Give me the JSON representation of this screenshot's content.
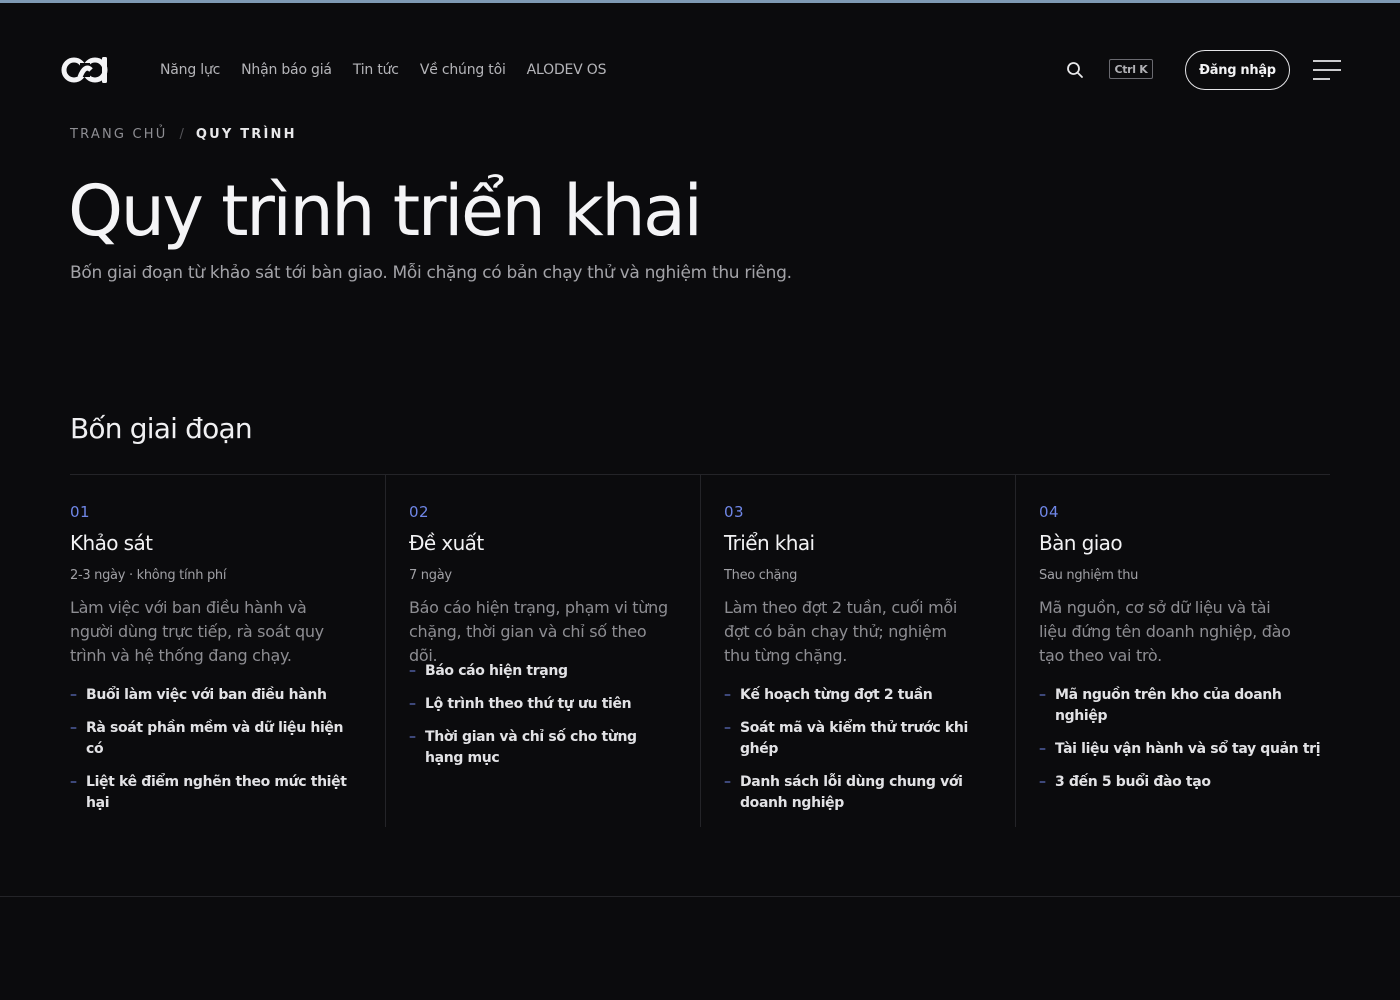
{
  "nav": {
    "items": [
      "Năng lực",
      "Nhận báo giá",
      "Tin tức",
      "Về chúng tôi",
      "ALODEV OS"
    ],
    "search_shortcut": "Ctrl K",
    "login_label": "Đăng nhập"
  },
  "breadcrumb": {
    "home": "TRANG CHỦ",
    "separator": "/",
    "current": "QUY TRÌNH"
  },
  "hero": {
    "title": "Quy trình triển khai",
    "subtitle": "Bốn giai đoạn từ khảo sát tới bàn giao. Mỗi chặng có bản chạy thử và nghiệm thu riêng."
  },
  "section": {
    "title": "Bốn giai đoạn"
  },
  "phases": [
    {
      "number": "01",
      "title": "Khảo sát",
      "meta": "2-3 ngày · không tính phí",
      "description": "Làm việc với ban điều hành và người dùng trực tiếp, rà soát quy trình và hệ thống đang chạy.",
      "items": [
        "Buổi làm việc với ban điều hành",
        "Rà soát phần mềm và dữ liệu hiện có",
        "Liệt kê điểm nghẽn theo mức thiệt hại"
      ]
    },
    {
      "number": "02",
      "title": "Đề xuất",
      "meta": "7 ngày",
      "description": "Báo cáo hiện trạng, phạm vi từng chặng, thời gian và chỉ số theo dõi.",
      "items": [
        "Báo cáo hiện trạng",
        "Lộ trình theo thứ tự ưu tiên",
        "Thời gian và chỉ số cho từng hạng mục"
      ]
    },
    {
      "number": "03",
      "title": "Triển khai",
      "meta": "Theo chặng",
      "description": "Làm theo đợt 2 tuần, cuối mỗi đợt có bản chạy thử; nghiệm thu từng chặng.",
      "items": [
        "Kế hoạch từng đợt 2 tuần",
        "Soát mã và kiểm thử trước khi ghép",
        "Danh sách lỗi dùng chung với doanh nghiệp"
      ]
    },
    {
      "number": "04",
      "title": "Bàn giao",
      "meta": "Sau nghiệm thu",
      "description": "Mã nguồn, cơ sở dữ liệu và tài liệu đứng tên doanh nghiệp, đào tạo theo vai trò.",
      "items": [
        "Mã nguồn trên kho của doanh nghiệp",
        "Tài liệu vận hành và sổ tay quản trị",
        "3 đến 5 buổi đào tạo"
      ]
    }
  ],
  "icons": {
    "logo": "logo-icon",
    "search": "search-icon",
    "menu": "menu-icon"
  },
  "colors": {
    "background": "#0b0b0d",
    "accent": "#6f86e6",
    "top_bar": "#7f9ab4"
  }
}
